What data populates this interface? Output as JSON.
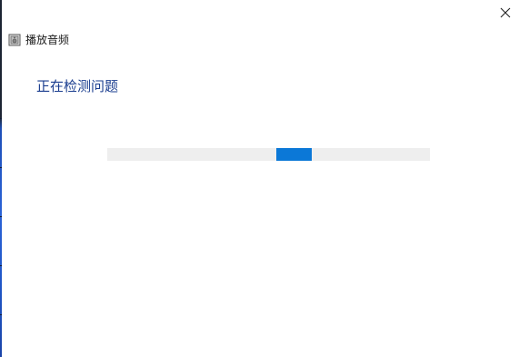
{
  "window": {
    "title": "播放音频",
    "close_icon": "close-icon",
    "app_icon": "speaker-troubleshooter-icon"
  },
  "main": {
    "heading": "正在检测问题",
    "progress": {
      "mode": "indeterminate",
      "indicator_start_fraction": 0.524,
      "indicator_width_fraction": 0.11,
      "track_color": "#eeeeee",
      "indicator_color": "#0b78d7"
    }
  },
  "colors": {
    "heading": "#1a3d8f",
    "accent": "#0b78d7"
  }
}
